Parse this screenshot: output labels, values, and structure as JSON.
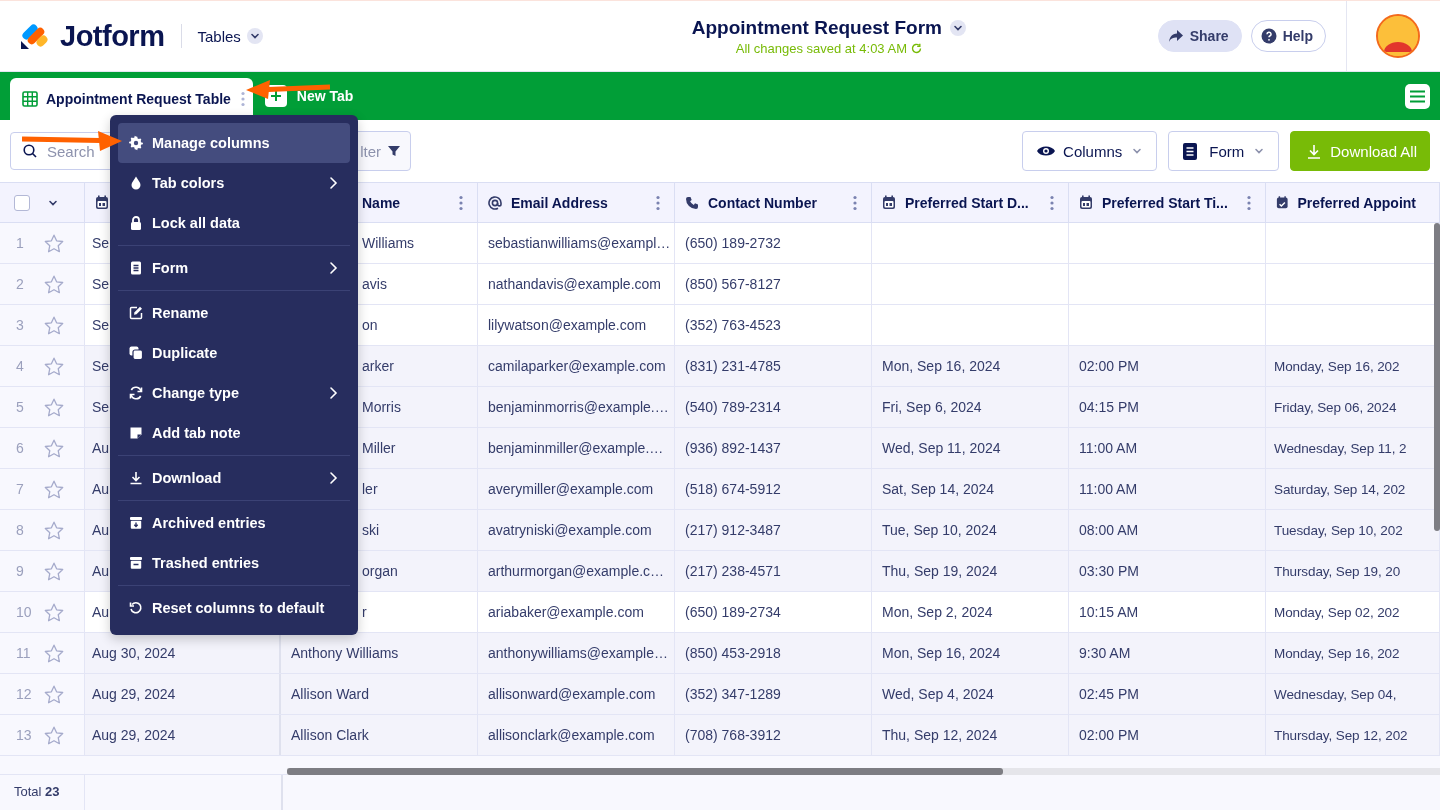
{
  "header": {
    "logo": "Jotform",
    "product": "Tables",
    "title": "Appointment Request Form",
    "save_status": "All changes saved at 4:03 AM",
    "buttons": [
      {
        "kind": "share",
        "label": "Share"
      },
      {
        "kind": "help",
        "label": "Help"
      }
    ]
  },
  "tabs": [
    {
      "label": "Appointment Request Table",
      "selected": true
    }
  ],
  "new_tab": "New Tab",
  "toolbar": {
    "search": {
      "placeholder": "Search"
    },
    "filter": "lter",
    "buttons": [
      {
        "kind": "columns",
        "label": "Columns"
      },
      {
        "kind": "form",
        "label": "Form"
      },
      {
        "kind": "download",
        "label": "Download All"
      }
    ]
  },
  "table": {
    "select_all": {
      "checked": false
    },
    "columns": [
      {
        "menu": false
      },
      {
        "label": "Name",
        "menu": true
      },
      {
        "label": "Email Address",
        "menu": true
      },
      {
        "label": "Contact Number",
        "menu": true
      },
      {
        "label": "Preferred Start D...",
        "menu": true
      },
      {
        "label": "Preferred Start Ti...",
        "menu": true
      },
      {
        "label": "Preferred Appoint",
        "menu": false
      }
    ],
    "rows": [
      {
        "number": "1",
        "starred": false,
        "highlighted": true,
        "cells": [
          "Se",
          "Williams",
          "sebastianwilliams@exampl…",
          "(650) 189-2732"
        ]
      },
      {
        "number": "2",
        "starred": false,
        "highlighted": true,
        "cells": [
          "Se",
          "avis",
          "nathandavis@example.com",
          "(850) 567-8127"
        ]
      },
      {
        "number": "3",
        "starred": false,
        "highlighted": true,
        "cells": [
          "Se",
          "on",
          "lilywatson@example.com",
          "(352) 763-4523"
        ]
      },
      {
        "number": "4",
        "starred": false,
        "highlighted": false,
        "cells": [
          "Se",
          "arker",
          "camilaparker@example.com",
          "(831) 231-4785",
          "Mon, Sep 16, 2024",
          "02:00 PM",
          "Monday, Sep 16, 202"
        ]
      },
      {
        "number": "5",
        "starred": false,
        "highlighted": false,
        "cells": [
          "Se",
          "Morris",
          "benjaminmorris@example.…",
          "(540) 789-2314",
          "Fri, Sep 6, 2024",
          "04:15 PM",
          "Friday, Sep 06, 2024"
        ]
      },
      {
        "number": "6",
        "starred": false,
        "highlighted": false,
        "cells": [
          "Au",
          "Miller",
          "benjaminmiller@example.…",
          "(936) 892-1437",
          "Wed, Sep 11, 2024",
          "11:00 AM",
          "Wednesday, Sep 11, 2"
        ]
      },
      {
        "number": "7",
        "starred": false,
        "highlighted": false,
        "cells": [
          "Au",
          "ler",
          "averymiller@example.com",
          "(518) 674-5912",
          "Sat, Sep 14, 2024",
          "11:00 AM",
          "Saturday, Sep 14, 202"
        ]
      },
      {
        "number": "8",
        "starred": false,
        "highlighted": false,
        "cells": [
          "Au",
          "ski",
          "avatryniski@example.com",
          "(217) 912-3487",
          "Tue, Sep 10, 2024",
          "08:00 AM",
          "Tuesday, Sep 10, 202"
        ]
      },
      {
        "number": "9",
        "starred": false,
        "highlighted": false,
        "cells": [
          "Au",
          "organ",
          "arthurmorgan@example.c…",
          "(217) 238-4571",
          "Thu, Sep 19, 2024",
          "03:30 PM",
          "Thursday, Sep 19, 20"
        ]
      },
      {
        "number": "10",
        "starred": false,
        "highlighted": true,
        "cells": [
          "Au",
          "r",
          "ariabaker@example.com",
          "(650) 189-2734",
          "Mon, Sep 2, 2024",
          "10:15 AM",
          "Monday, Sep 02, 202"
        ]
      },
      {
        "number": "11",
        "starred": false,
        "highlighted": false,
        "cells": [
          "Aug 30, 2024",
          "Anthony Williams",
          "anthonywilliams@example…",
          "(850) 453-2918",
          "Mon, Sep 16, 2024",
          "9:30 AM",
          "Monday, Sep 16, 202"
        ]
      },
      {
        "number": "12",
        "starred": false,
        "highlighted": false,
        "cells": [
          "Aug 29, 2024",
          "Allison Ward",
          "allisonward@example.com",
          "(352) 347-1289",
          "Wed, Sep 4, 2024",
          "02:45 PM",
          "Wednesday, Sep 04,"
        ]
      },
      {
        "number": "13",
        "starred": false,
        "highlighted": false,
        "cells": [
          "Aug 29, 2024",
          "Allison Clark",
          "allisonclark@example.com",
          "(708) 768-3912",
          "Thu, Sep 12, 2024",
          "02:00 PM",
          "Thursday, Sep 12, 202"
        ]
      }
    ],
    "total": "Total **23**"
  },
  "tab_menu": {
    "items": [
      {
        "kind": "item",
        "label": "Manage columns",
        "submenu": false,
        "selected": true
      },
      {
        "kind": "item",
        "label": "Tab colors",
        "submenu": true,
        "selected": false
      },
      {
        "kind": "item",
        "label": "Lock all data",
        "submenu": false,
        "selected": false
      },
      {
        "kind": "divider"
      },
      {
        "kind": "item",
        "label": "Form",
        "submenu": true,
        "selected": false
      },
      {
        "kind": "divider"
      },
      {
        "kind": "item",
        "label": "Rename",
        "submenu": false,
        "selected": false
      },
      {
        "kind": "item",
        "label": "Duplicate",
        "submenu": false,
        "selected": false
      },
      {
        "kind": "item",
        "label": "Change type",
        "submenu": true,
        "selected": false
      },
      {
        "kind": "item",
        "label": "Add tab note",
        "submenu": false,
        "selected": false
      },
      {
        "kind": "divider"
      },
      {
        "kind": "item",
        "label": "Download",
        "submenu": true,
        "selected": false
      },
      {
        "kind": "divider"
      },
      {
        "kind": "item",
        "label": "Archived entries",
        "submenu": false,
        "selected": false
      },
      {
        "kind": "item",
        "label": "Trashed entries",
        "submenu": false,
        "selected": false
      },
      {
        "kind": "divider"
      },
      {
        "kind": "item",
        "label": "Reset columns to default",
        "submenu": false,
        "selected": false
      }
    ]
  }
}
